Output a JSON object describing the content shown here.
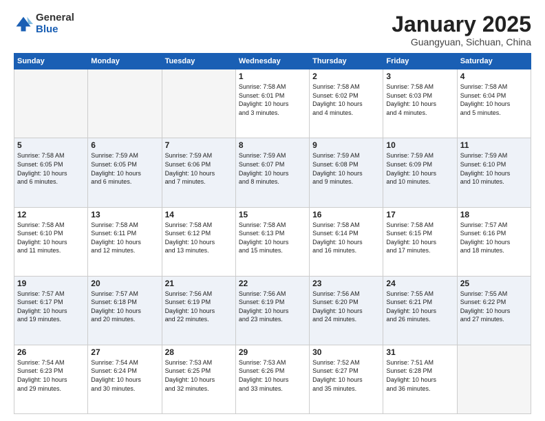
{
  "logo": {
    "general": "General",
    "blue": "Blue"
  },
  "header": {
    "month": "January 2025",
    "location": "Guangyuan, Sichuan, China"
  },
  "weekdays": [
    "Sunday",
    "Monday",
    "Tuesday",
    "Wednesday",
    "Thursday",
    "Friday",
    "Saturday"
  ],
  "weeks": [
    [
      {
        "day": "",
        "info": "",
        "empty": true
      },
      {
        "day": "",
        "info": "",
        "empty": true
      },
      {
        "day": "",
        "info": "",
        "empty": true
      },
      {
        "day": "1",
        "info": "Sunrise: 7:58 AM\nSunset: 6:01 PM\nDaylight: 10 hours\nand 3 minutes.",
        "empty": false
      },
      {
        "day": "2",
        "info": "Sunrise: 7:58 AM\nSunset: 6:02 PM\nDaylight: 10 hours\nand 4 minutes.",
        "empty": false
      },
      {
        "day": "3",
        "info": "Sunrise: 7:58 AM\nSunset: 6:03 PM\nDaylight: 10 hours\nand 4 minutes.",
        "empty": false
      },
      {
        "day": "4",
        "info": "Sunrise: 7:58 AM\nSunset: 6:04 PM\nDaylight: 10 hours\nand 5 minutes.",
        "empty": false
      }
    ],
    [
      {
        "day": "5",
        "info": "Sunrise: 7:58 AM\nSunset: 6:05 PM\nDaylight: 10 hours\nand 6 minutes.",
        "empty": false
      },
      {
        "day": "6",
        "info": "Sunrise: 7:59 AM\nSunset: 6:05 PM\nDaylight: 10 hours\nand 6 minutes.",
        "empty": false
      },
      {
        "day": "7",
        "info": "Sunrise: 7:59 AM\nSunset: 6:06 PM\nDaylight: 10 hours\nand 7 minutes.",
        "empty": false
      },
      {
        "day": "8",
        "info": "Sunrise: 7:59 AM\nSunset: 6:07 PM\nDaylight: 10 hours\nand 8 minutes.",
        "empty": false
      },
      {
        "day": "9",
        "info": "Sunrise: 7:59 AM\nSunset: 6:08 PM\nDaylight: 10 hours\nand 9 minutes.",
        "empty": false
      },
      {
        "day": "10",
        "info": "Sunrise: 7:59 AM\nSunset: 6:09 PM\nDaylight: 10 hours\nand 10 minutes.",
        "empty": false
      },
      {
        "day": "11",
        "info": "Sunrise: 7:59 AM\nSunset: 6:10 PM\nDaylight: 10 hours\nand 10 minutes.",
        "empty": false
      }
    ],
    [
      {
        "day": "12",
        "info": "Sunrise: 7:58 AM\nSunset: 6:10 PM\nDaylight: 10 hours\nand 11 minutes.",
        "empty": false
      },
      {
        "day": "13",
        "info": "Sunrise: 7:58 AM\nSunset: 6:11 PM\nDaylight: 10 hours\nand 12 minutes.",
        "empty": false
      },
      {
        "day": "14",
        "info": "Sunrise: 7:58 AM\nSunset: 6:12 PM\nDaylight: 10 hours\nand 13 minutes.",
        "empty": false
      },
      {
        "day": "15",
        "info": "Sunrise: 7:58 AM\nSunset: 6:13 PM\nDaylight: 10 hours\nand 15 minutes.",
        "empty": false
      },
      {
        "day": "16",
        "info": "Sunrise: 7:58 AM\nSunset: 6:14 PM\nDaylight: 10 hours\nand 16 minutes.",
        "empty": false
      },
      {
        "day": "17",
        "info": "Sunrise: 7:58 AM\nSunset: 6:15 PM\nDaylight: 10 hours\nand 17 minutes.",
        "empty": false
      },
      {
        "day": "18",
        "info": "Sunrise: 7:57 AM\nSunset: 6:16 PM\nDaylight: 10 hours\nand 18 minutes.",
        "empty": false
      }
    ],
    [
      {
        "day": "19",
        "info": "Sunrise: 7:57 AM\nSunset: 6:17 PM\nDaylight: 10 hours\nand 19 minutes.",
        "empty": false
      },
      {
        "day": "20",
        "info": "Sunrise: 7:57 AM\nSunset: 6:18 PM\nDaylight: 10 hours\nand 20 minutes.",
        "empty": false
      },
      {
        "day": "21",
        "info": "Sunrise: 7:56 AM\nSunset: 6:19 PM\nDaylight: 10 hours\nand 22 minutes.",
        "empty": false
      },
      {
        "day": "22",
        "info": "Sunrise: 7:56 AM\nSunset: 6:19 PM\nDaylight: 10 hours\nand 23 minutes.",
        "empty": false
      },
      {
        "day": "23",
        "info": "Sunrise: 7:56 AM\nSunset: 6:20 PM\nDaylight: 10 hours\nand 24 minutes.",
        "empty": false
      },
      {
        "day": "24",
        "info": "Sunrise: 7:55 AM\nSunset: 6:21 PM\nDaylight: 10 hours\nand 26 minutes.",
        "empty": false
      },
      {
        "day": "25",
        "info": "Sunrise: 7:55 AM\nSunset: 6:22 PM\nDaylight: 10 hours\nand 27 minutes.",
        "empty": false
      }
    ],
    [
      {
        "day": "26",
        "info": "Sunrise: 7:54 AM\nSunset: 6:23 PM\nDaylight: 10 hours\nand 29 minutes.",
        "empty": false
      },
      {
        "day": "27",
        "info": "Sunrise: 7:54 AM\nSunset: 6:24 PM\nDaylight: 10 hours\nand 30 minutes.",
        "empty": false
      },
      {
        "day": "28",
        "info": "Sunrise: 7:53 AM\nSunset: 6:25 PM\nDaylight: 10 hours\nand 32 minutes.",
        "empty": false
      },
      {
        "day": "29",
        "info": "Sunrise: 7:53 AM\nSunset: 6:26 PM\nDaylight: 10 hours\nand 33 minutes.",
        "empty": false
      },
      {
        "day": "30",
        "info": "Sunrise: 7:52 AM\nSunset: 6:27 PM\nDaylight: 10 hours\nand 35 minutes.",
        "empty": false
      },
      {
        "day": "31",
        "info": "Sunrise: 7:51 AM\nSunset: 6:28 PM\nDaylight: 10 hours\nand 36 minutes.",
        "empty": false
      },
      {
        "day": "",
        "info": "",
        "empty": true
      }
    ]
  ]
}
